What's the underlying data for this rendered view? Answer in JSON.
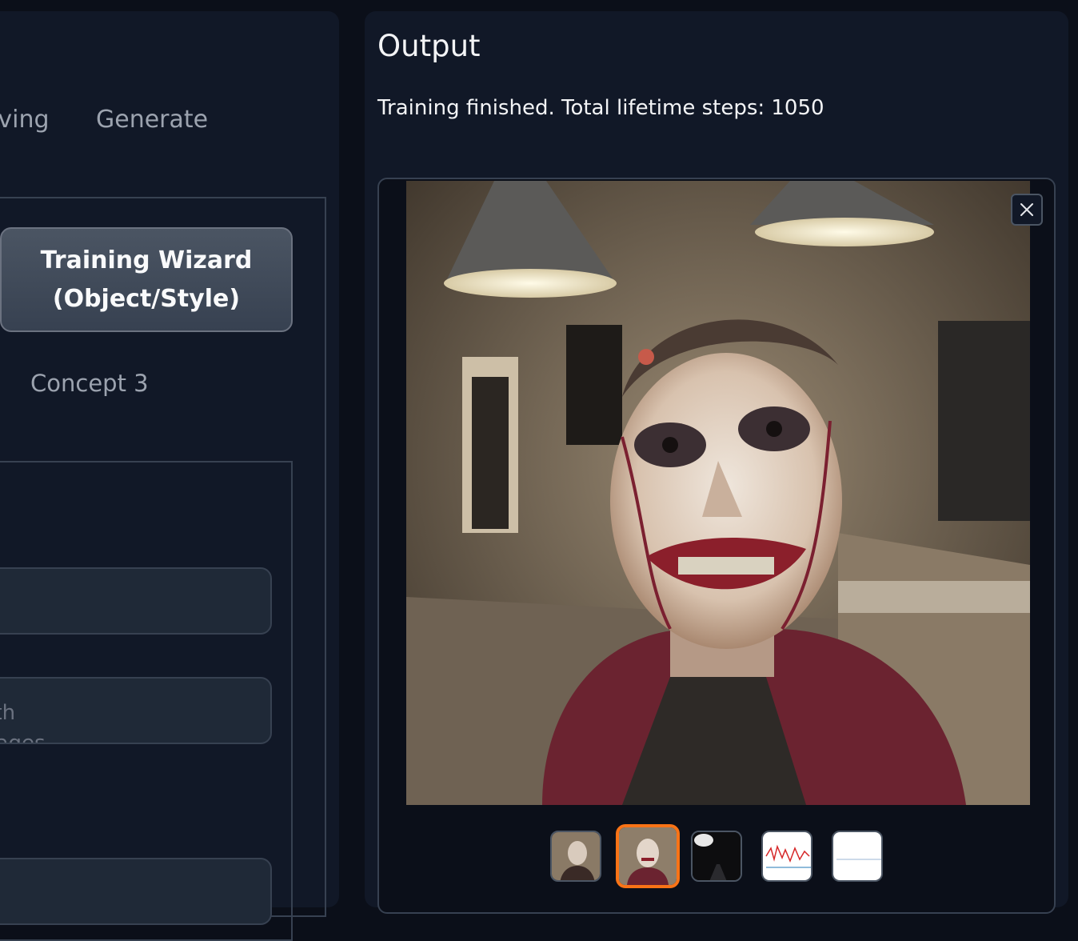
{
  "tabs": {
    "saving_label": "Saving",
    "generate_label": "Generate"
  },
  "left": {
    "wizard_button_line1": "Training Wizard",
    "wizard_button_line2": "(Object/Style)",
    "concept_tab": "Concept 3",
    "field2_placeholder_line1": "Path",
    "field2_placeholder_line2": "images"
  },
  "output": {
    "title": "Output",
    "status": "Training finished. Total lifetime steps: 1050"
  },
  "gallery": {
    "main_image_alt": "generated portrait",
    "thumbnails": [
      {
        "name": "thumbnail-1-portrait",
        "selected": false
      },
      {
        "name": "thumbnail-2-portrait",
        "selected": true
      },
      {
        "name": "thumbnail-3-dark",
        "selected": false
      },
      {
        "name": "thumbnail-4-loss-chart",
        "selected": false
      },
      {
        "name": "thumbnail-5-chart",
        "selected": false
      }
    ]
  },
  "icons": {
    "close": "close-icon"
  },
  "colors": {
    "panel": "#111827",
    "background": "#0b0f19",
    "selected_thumb_border": "#f97316"
  }
}
